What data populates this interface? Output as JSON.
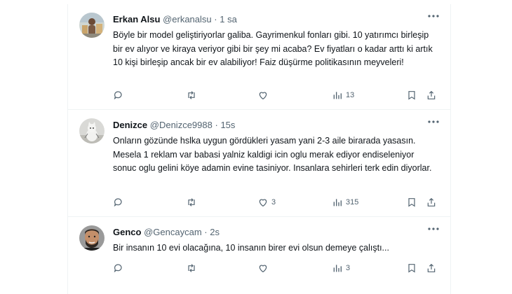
{
  "tweets": [
    {
      "name": "Erkan Alsu",
      "handle": "@erkanalsu",
      "dot": "·",
      "time": "1 sa",
      "text": "Böyle bir model geliştiriyorlar galiba. Gayrimenkul fonları gibi. 10 yatırımcı birleşip bir ev alıyor ve kiraya veriyor gibi bir şey mi acaba? Ev fiyatları o kadar arttı ki artık 10 kişi birleşip ancak bir ev alabiliyor! Faiz düşürme politikasının meyveleri!",
      "replies": "",
      "retweets": "",
      "likes": "",
      "views": "13"
    },
    {
      "name": "Denizce",
      "handle": "@Denizce9988",
      "dot": "·",
      "time": "15s",
      "text": "Onların gözünde hslka uygun gördükleri yasam yani 2-3 aile birarada yasasın. Mesela 1 reklam var babasi yalniz kaldigi icin oglu merak ediyor endiseleniyor sonuc oglu gelini köye adamin evine tasiniyor. Insanlara sehirleri terk edin diyorlar.",
      "replies": "",
      "retweets": "",
      "likes": "3",
      "views": "315"
    },
    {
      "name": "Genco",
      "handle": "@Gencaycam",
      "dot": "·",
      "time": "2s",
      "text": "Bir insanın 10 evi olacağına, 10 insanın birer evi olsun demeye çalıştı...",
      "replies": "",
      "retweets": "",
      "likes": "",
      "views": "3"
    }
  ],
  "icons": [
    "more-icon",
    "reply-icon",
    "retweet-icon",
    "like-icon",
    "views-icon",
    "bookmark-icon",
    "share-icon"
  ],
  "colors": {
    "text": "#0f1419",
    "secondary": "#536471",
    "border": "#eff3f4"
  }
}
